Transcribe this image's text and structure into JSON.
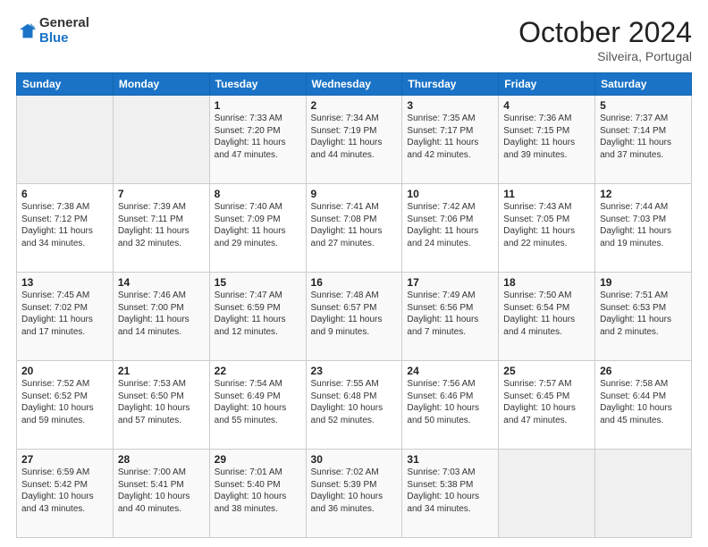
{
  "logo": {
    "general": "General",
    "blue": "Blue"
  },
  "title": "October 2024",
  "location": "Silveira, Portugal",
  "days_of_week": [
    "Sunday",
    "Monday",
    "Tuesday",
    "Wednesday",
    "Thursday",
    "Friday",
    "Saturday"
  ],
  "weeks": [
    [
      {
        "day": "",
        "sunrise": "",
        "sunset": "",
        "daylight": ""
      },
      {
        "day": "",
        "sunrise": "",
        "sunset": "",
        "daylight": ""
      },
      {
        "day": "1",
        "sunrise": "Sunrise: 7:33 AM",
        "sunset": "Sunset: 7:20 PM",
        "daylight": "Daylight: 11 hours and 47 minutes."
      },
      {
        "day": "2",
        "sunrise": "Sunrise: 7:34 AM",
        "sunset": "Sunset: 7:19 PM",
        "daylight": "Daylight: 11 hours and 44 minutes."
      },
      {
        "day": "3",
        "sunrise": "Sunrise: 7:35 AM",
        "sunset": "Sunset: 7:17 PM",
        "daylight": "Daylight: 11 hours and 42 minutes."
      },
      {
        "day": "4",
        "sunrise": "Sunrise: 7:36 AM",
        "sunset": "Sunset: 7:15 PM",
        "daylight": "Daylight: 11 hours and 39 minutes."
      },
      {
        "day": "5",
        "sunrise": "Sunrise: 7:37 AM",
        "sunset": "Sunset: 7:14 PM",
        "daylight": "Daylight: 11 hours and 37 minutes."
      }
    ],
    [
      {
        "day": "6",
        "sunrise": "Sunrise: 7:38 AM",
        "sunset": "Sunset: 7:12 PM",
        "daylight": "Daylight: 11 hours and 34 minutes."
      },
      {
        "day": "7",
        "sunrise": "Sunrise: 7:39 AM",
        "sunset": "Sunset: 7:11 PM",
        "daylight": "Daylight: 11 hours and 32 minutes."
      },
      {
        "day": "8",
        "sunrise": "Sunrise: 7:40 AM",
        "sunset": "Sunset: 7:09 PM",
        "daylight": "Daylight: 11 hours and 29 minutes."
      },
      {
        "day": "9",
        "sunrise": "Sunrise: 7:41 AM",
        "sunset": "Sunset: 7:08 PM",
        "daylight": "Daylight: 11 hours and 27 minutes."
      },
      {
        "day": "10",
        "sunrise": "Sunrise: 7:42 AM",
        "sunset": "Sunset: 7:06 PM",
        "daylight": "Daylight: 11 hours and 24 minutes."
      },
      {
        "day": "11",
        "sunrise": "Sunrise: 7:43 AM",
        "sunset": "Sunset: 7:05 PM",
        "daylight": "Daylight: 11 hours and 22 minutes."
      },
      {
        "day": "12",
        "sunrise": "Sunrise: 7:44 AM",
        "sunset": "Sunset: 7:03 PM",
        "daylight": "Daylight: 11 hours and 19 minutes."
      }
    ],
    [
      {
        "day": "13",
        "sunrise": "Sunrise: 7:45 AM",
        "sunset": "Sunset: 7:02 PM",
        "daylight": "Daylight: 11 hours and 17 minutes."
      },
      {
        "day": "14",
        "sunrise": "Sunrise: 7:46 AM",
        "sunset": "Sunset: 7:00 PM",
        "daylight": "Daylight: 11 hours and 14 minutes."
      },
      {
        "day": "15",
        "sunrise": "Sunrise: 7:47 AM",
        "sunset": "Sunset: 6:59 PM",
        "daylight": "Daylight: 11 hours and 12 minutes."
      },
      {
        "day": "16",
        "sunrise": "Sunrise: 7:48 AM",
        "sunset": "Sunset: 6:57 PM",
        "daylight": "Daylight: 11 hours and 9 minutes."
      },
      {
        "day": "17",
        "sunrise": "Sunrise: 7:49 AM",
        "sunset": "Sunset: 6:56 PM",
        "daylight": "Daylight: 11 hours and 7 minutes."
      },
      {
        "day": "18",
        "sunrise": "Sunrise: 7:50 AM",
        "sunset": "Sunset: 6:54 PM",
        "daylight": "Daylight: 11 hours and 4 minutes."
      },
      {
        "day": "19",
        "sunrise": "Sunrise: 7:51 AM",
        "sunset": "Sunset: 6:53 PM",
        "daylight": "Daylight: 11 hours and 2 minutes."
      }
    ],
    [
      {
        "day": "20",
        "sunrise": "Sunrise: 7:52 AM",
        "sunset": "Sunset: 6:52 PM",
        "daylight": "Daylight: 10 hours and 59 minutes."
      },
      {
        "day": "21",
        "sunrise": "Sunrise: 7:53 AM",
        "sunset": "Sunset: 6:50 PM",
        "daylight": "Daylight: 10 hours and 57 minutes."
      },
      {
        "day": "22",
        "sunrise": "Sunrise: 7:54 AM",
        "sunset": "Sunset: 6:49 PM",
        "daylight": "Daylight: 10 hours and 55 minutes."
      },
      {
        "day": "23",
        "sunrise": "Sunrise: 7:55 AM",
        "sunset": "Sunset: 6:48 PM",
        "daylight": "Daylight: 10 hours and 52 minutes."
      },
      {
        "day": "24",
        "sunrise": "Sunrise: 7:56 AM",
        "sunset": "Sunset: 6:46 PM",
        "daylight": "Daylight: 10 hours and 50 minutes."
      },
      {
        "day": "25",
        "sunrise": "Sunrise: 7:57 AM",
        "sunset": "Sunset: 6:45 PM",
        "daylight": "Daylight: 10 hours and 47 minutes."
      },
      {
        "day": "26",
        "sunrise": "Sunrise: 7:58 AM",
        "sunset": "Sunset: 6:44 PM",
        "daylight": "Daylight: 10 hours and 45 minutes."
      }
    ],
    [
      {
        "day": "27",
        "sunrise": "Sunrise: 6:59 AM",
        "sunset": "Sunset: 5:42 PM",
        "daylight": "Daylight: 10 hours and 43 minutes."
      },
      {
        "day": "28",
        "sunrise": "Sunrise: 7:00 AM",
        "sunset": "Sunset: 5:41 PM",
        "daylight": "Daylight: 10 hours and 40 minutes."
      },
      {
        "day": "29",
        "sunrise": "Sunrise: 7:01 AM",
        "sunset": "Sunset: 5:40 PM",
        "daylight": "Daylight: 10 hours and 38 minutes."
      },
      {
        "day": "30",
        "sunrise": "Sunrise: 7:02 AM",
        "sunset": "Sunset: 5:39 PM",
        "daylight": "Daylight: 10 hours and 36 minutes."
      },
      {
        "day": "31",
        "sunrise": "Sunrise: 7:03 AM",
        "sunset": "Sunset: 5:38 PM",
        "daylight": "Daylight: 10 hours and 34 minutes."
      },
      {
        "day": "",
        "sunrise": "",
        "sunset": "",
        "daylight": ""
      },
      {
        "day": "",
        "sunrise": "",
        "sunset": "",
        "daylight": ""
      }
    ]
  ]
}
